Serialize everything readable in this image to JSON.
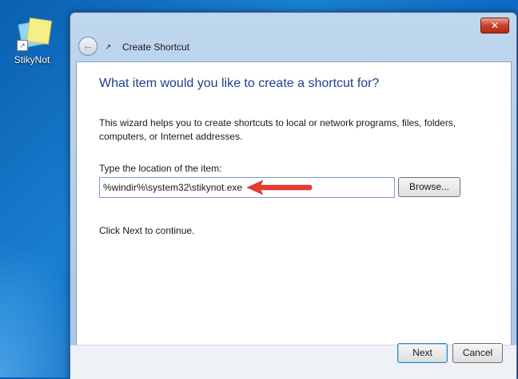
{
  "desktop": {
    "icon_label": "StikyNot"
  },
  "window": {
    "title": "Create Shortcut",
    "close_glyph": "✕",
    "back_glyph": "←"
  },
  "wizard": {
    "heading": "What item would you like to create a shortcut for?",
    "description": "This wizard helps you to create shortcuts to local or network programs, files, folders, computers, or Internet addresses.",
    "field_label": "Type the location of the item:",
    "location_value": "%windir%\\system32\\stikynot.exe",
    "browse_label": "Browse...",
    "continue_text": "Click Next to continue."
  },
  "buttons": {
    "next_label": "Next",
    "cancel_label": "Cancel"
  },
  "colors": {
    "heading": "#1e3f8f",
    "annotation_arrow": "#e53b31"
  }
}
